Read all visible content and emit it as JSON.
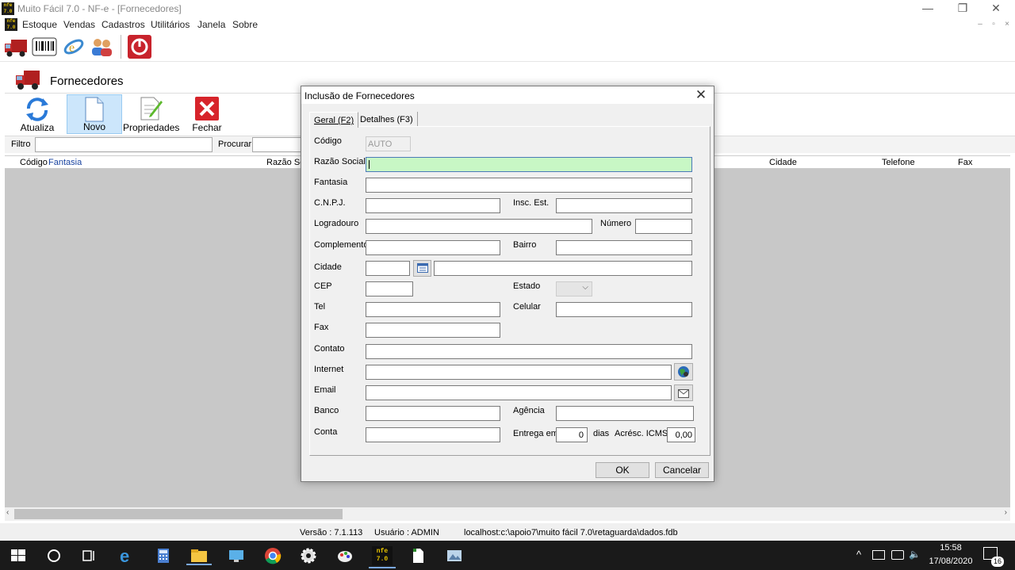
{
  "window": {
    "title": "Muito Fácil 7.0 - NF-e - [Fornecedores]",
    "minimize": "—",
    "restore": "❐",
    "close": "✕"
  },
  "menu": [
    "Estoque",
    "Vendas",
    "Cadastros",
    "Utilitários",
    "Janela",
    "Sobre"
  ],
  "mdi_controls": [
    "–",
    "▫",
    "×"
  ],
  "panel": {
    "title": "Fornecedores"
  },
  "ribbon": {
    "atualiza": "Atualiza",
    "novo": "Novo",
    "propriedades": "Propriedades",
    "fechar": "Fechar"
  },
  "filter": {
    "filtro_label": "Filtro",
    "filtro_value": "",
    "procurar_label": "Procurar",
    "procurar_value": ""
  },
  "grid": {
    "columns": [
      "Código",
      "Fantasia",
      "Razão So",
      "Cidade",
      "Telefone",
      "Fax"
    ]
  },
  "status": {
    "versao": "Versão : 7.1.113",
    "usuario": "Usuário : ADMIN",
    "db": "localhost:c:\\apoio7\\muito fácil 7.0\\retaguarda\\dados.fdb"
  },
  "taskbar": {
    "time": "15:58",
    "date": "17/08/2020",
    "notif": "16",
    "nfe_icon": "nfe 7.0"
  },
  "dialog": {
    "title": "Inclusão de Fornecedores",
    "close": "✕",
    "tabs": [
      "Geral (F2)",
      "Detalhes (F3)"
    ],
    "labels": {
      "codigo": "Código",
      "razao": "Razão Social",
      "fantasia": "Fantasia",
      "cnpj": "C.N.P.J.",
      "insc": "Insc. Est.",
      "logradouro": "Logradouro",
      "numero": "Número",
      "complemento": "Complemento",
      "bairro": "Bairro",
      "cidade": "Cidade",
      "cep": "CEP",
      "estado": "Estado",
      "tel": "Tel",
      "celular": "Celular",
      "fax": "Fax",
      "contato": "Contato",
      "internet": "Internet",
      "email": "Email",
      "banco": "Banco",
      "agencia": "Agência",
      "conta": "Conta",
      "entrega": "Entrega em",
      "dias": "dias",
      "acresc": "Acrésc. ICMS"
    },
    "values": {
      "codigo": "AUTO",
      "entrega": "0",
      "acresc": "0,00"
    },
    "buttons": {
      "ok": "OK",
      "cancel": "Cancelar"
    }
  },
  "colors": {
    "active_field": "#c8f7c5",
    "selected_button": "#cce6fb",
    "taskbar": "#1a1a1a"
  }
}
